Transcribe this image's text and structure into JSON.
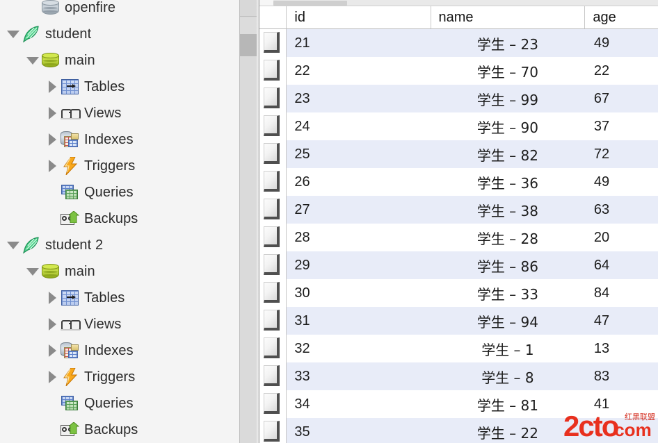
{
  "sidebar": {
    "tree": [
      {
        "level": 1,
        "twisty": "none",
        "icon": "database-gray-icon",
        "label": "openfire"
      },
      {
        "level": 0,
        "twisty": "open",
        "icon": "feather-green-icon",
        "label": "student"
      },
      {
        "level": 1,
        "twisty": "open",
        "icon": "database-green-icon",
        "label": "main"
      },
      {
        "level": 2,
        "twisty": "closed",
        "icon": "tables-icon",
        "label": "Tables"
      },
      {
        "level": 2,
        "twisty": "closed",
        "icon": "views-glasses-icon",
        "label": "Views"
      },
      {
        "level": 2,
        "twisty": "closed",
        "icon": "indexes-icon",
        "label": "Indexes"
      },
      {
        "level": 2,
        "twisty": "closed",
        "icon": "triggers-bolt-icon",
        "label": "Triggers"
      },
      {
        "level": 2,
        "twisty": "none",
        "icon": "queries-icon",
        "label": "Queries"
      },
      {
        "level": 2,
        "twisty": "none",
        "icon": "backups-tape-icon",
        "label": "Backups"
      },
      {
        "level": 0,
        "twisty": "open",
        "icon": "feather-green-icon",
        "label": "student 2"
      },
      {
        "level": 1,
        "twisty": "open",
        "icon": "database-green-icon",
        "label": "main"
      },
      {
        "level": 2,
        "twisty": "closed",
        "icon": "tables-icon",
        "label": "Tables"
      },
      {
        "level": 2,
        "twisty": "closed",
        "icon": "views-glasses-icon",
        "label": "Views"
      },
      {
        "level": 2,
        "twisty": "closed",
        "icon": "indexes-icon",
        "label": "Indexes"
      },
      {
        "level": 2,
        "twisty": "closed",
        "icon": "triggers-bolt-icon",
        "label": "Triggers"
      },
      {
        "level": 2,
        "twisty": "none",
        "icon": "queries-icon",
        "label": "Queries"
      },
      {
        "level": 2,
        "twisty": "none",
        "icon": "backups-tape-icon",
        "label": "Backups"
      }
    ]
  },
  "grid": {
    "columns": [
      "id",
      "name",
      "age"
    ],
    "rows": [
      {
        "id": "21",
        "name": "学生 – 23",
        "age": "49"
      },
      {
        "id": "22",
        "name": "学生 – 70",
        "age": "22"
      },
      {
        "id": "23",
        "name": "学生 – 99",
        "age": "67"
      },
      {
        "id": "24",
        "name": "学生 – 90",
        "age": "37"
      },
      {
        "id": "25",
        "name": "学生 – 82",
        "age": "72"
      },
      {
        "id": "26",
        "name": "学生 – 36",
        "age": "49"
      },
      {
        "id": "27",
        "name": "学生 – 38",
        "age": "63"
      },
      {
        "id": "28",
        "name": "学生 – 28",
        "age": "20"
      },
      {
        "id": "29",
        "name": "学生 – 86",
        "age": "64"
      },
      {
        "id": "30",
        "name": "学生 – 33",
        "age": "84"
      },
      {
        "id": "31",
        "name": "学生 – 94",
        "age": "47"
      },
      {
        "id": "32",
        "name": "学生 – 1",
        "age": "13"
      },
      {
        "id": "33",
        "name": "学生 – 8",
        "age": "83"
      },
      {
        "id": "34",
        "name": "学生 – 81",
        "age": "41"
      },
      {
        "id": "35",
        "name": "学生 – 22",
        "age": ""
      }
    ]
  },
  "watermark": {
    "main_text": "2cto",
    "suffix_text": ".com",
    "cjk_text": "红黑联盟",
    "color": "#e8301e"
  },
  "colors": {
    "sidebar_bg": "#f4f4f4",
    "row_alt_bg": "#e8ecf8",
    "row_bg": "#ffffff",
    "grid_line": "#c8c8c8",
    "text": "#1c1c1c"
  }
}
